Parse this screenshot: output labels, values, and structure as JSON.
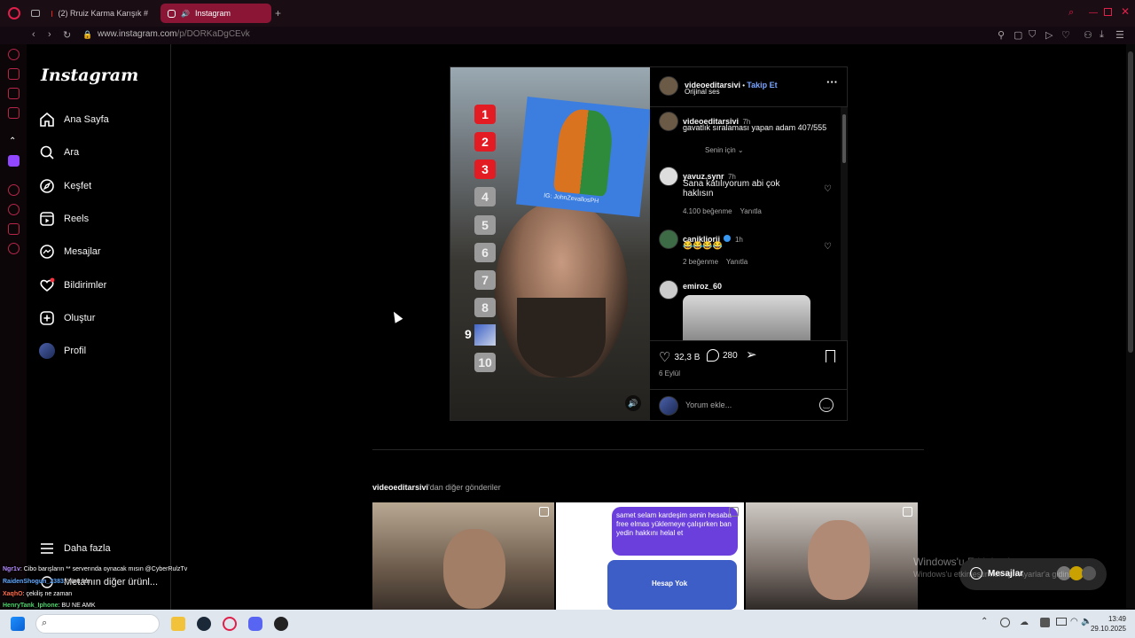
{
  "browser": {
    "tabs": [
      {
        "label": "(2) Rruiz Karma Karışık #",
        "active": false
      },
      {
        "label": "Instagram",
        "active": true
      }
    ],
    "url_host": "www.instagram.com",
    "url_path": "/p/DORKaDgCEvk",
    "accent": "#8a1535"
  },
  "nav": {
    "logo": "Instagram",
    "items": [
      {
        "label": "Ana Sayfa",
        "icon": "home-icon"
      },
      {
        "label": "Ara",
        "icon": "search-icon"
      },
      {
        "label": "Keşfet",
        "icon": "compass-icon"
      },
      {
        "label": "Reels",
        "icon": "reels-icon"
      },
      {
        "label": "Mesajlar",
        "icon": "messenger-icon"
      },
      {
        "label": "Bildirimler",
        "icon": "heart-icon"
      },
      {
        "label": "Oluştur",
        "icon": "plus-square-icon"
      },
      {
        "label": "Profil",
        "icon": "profile-avatar"
      }
    ],
    "more": "Daha fazla",
    "meta_more": "Meta'nın diğer ürünl..."
  },
  "video": {
    "ranks": [
      "1",
      "2",
      "3",
      "4",
      "5",
      "6",
      "7",
      "8",
      "9",
      "10"
    ],
    "sticker_caption": "IG: JohnZevallosPH"
  },
  "post": {
    "author": "videoeditarsivi",
    "follow_sep": " • ",
    "follow": "Takip Et",
    "audio": "Orijinal ses",
    "caption_user": "videoeditarsivi",
    "caption_time": "7h",
    "caption": "gavatlık sıralaması yapan adam 407/555",
    "for_you": "Senin için",
    "comments": [
      {
        "user": "yavuz.synr",
        "time": "7h",
        "text": "Sana katılıyorum abi çok haklısın",
        "likes": "4.100 beğenme",
        "reply": "Yanıtla"
      },
      {
        "user": "canikliorii",
        "time": "1h",
        "text": "😂😂😂😂",
        "likes": "2 beğenme",
        "reply": "Yanıtla"
      },
      {
        "user": "emiroz_60",
        "time": "",
        "text": ""
      }
    ],
    "like_count": "32,3 B",
    "comment_count": "280",
    "date": "6 Eylül",
    "comment_placeholder": "Yorum ekle..."
  },
  "more_posts": {
    "user": "videoeditarsivi",
    "suffix": "'dan diğer gönderiler",
    "bubble": "samet selam kardeşim senin hesaba free elmas yüklemeye çalışırken ban yedin hakkını helal et",
    "card": "Hesap Yok"
  },
  "chat": [
    {
      "name": "Ngr1v",
      "msg": ": Cibo barışların ** serverında oynacak mısın @CyberRulzTv"
    },
    {
      "name": "RaidenShogun_2383",
      "msg": ": Yürü lan"
    },
    {
      "name": "XaqhO",
      "msg": ": çekiliş ne zaman"
    },
    {
      "name": "HenryTank_Iphone",
      "msg": ": BU NE AMK"
    }
  ],
  "windows": {
    "watermark_title": "Windows'u Etkinleştir",
    "watermark_sub": "Windows'u etkinleştirmek için Ayarlar'a gidin.",
    "time": "13:49",
    "date": "29.10.2025"
  },
  "messages_pill": "Mesajlar"
}
